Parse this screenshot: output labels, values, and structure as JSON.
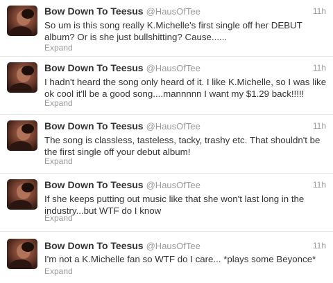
{
  "tweets": [
    {
      "name": "Bow Down To Teesus",
      "handle": "@HausOfTee",
      "time": "11h",
      "text": "So um is this song really K.Michelle's first single off her DEBUT album? Or is she just bullshitting? Cause......",
      "expand": "Expand"
    },
    {
      "name": "Bow Down To Teesus",
      "handle": "@HausOfTee",
      "time": "11h",
      "text": "I hadn't heard the song only heard of it. I like K.Michelle, so I was like ok cool it'll be a good song....mannnnn I want my $1.29 back!!!!!",
      "expand": "Expand"
    },
    {
      "name": "Bow Down To Teesus",
      "handle": "@HausOfTee",
      "time": "11h",
      "text": "The song is classless, tasteless, tacky, trashy etc. That shouldn't be the first single off your debut album!",
      "expand": "Expand"
    },
    {
      "name": "Bow Down To Teesus",
      "handle": "@HausOfTee",
      "time": "11h",
      "text": "If she keeps putting out music like that she won't last long in the industry...but WTF do I know",
      "expand": "Expand"
    },
    {
      "name": "Bow Down To Teesus",
      "handle": "@HausOfTee",
      "time": "11h",
      "text": "I'm not a K.Michelle fan so WTF do I care... *plays some Beyonce*",
      "expand": "Expand"
    }
  ]
}
